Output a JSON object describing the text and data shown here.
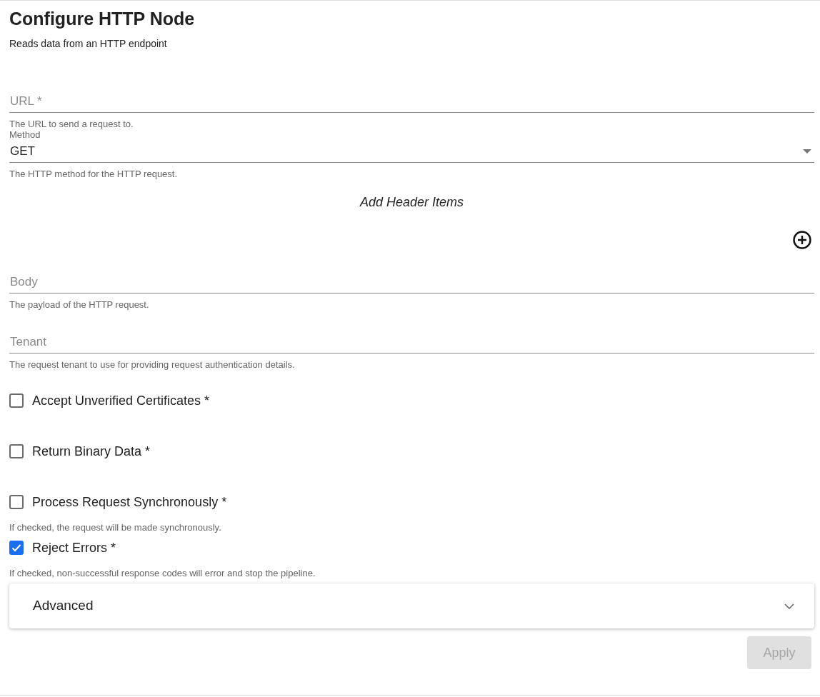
{
  "title": "Configure HTTP Node",
  "subtitle": "Reads data from an HTTP endpoint",
  "url_field": {
    "placeholder": "URL *",
    "helper": "The URL to send a request to."
  },
  "method_field": {
    "label": "Method",
    "value": "GET",
    "helper": "The HTTP method for the HTTP request."
  },
  "headers": {
    "title": "Add Header Items"
  },
  "body_field": {
    "placeholder": "Body",
    "helper": "The payload of the HTTP request."
  },
  "tenant_field": {
    "placeholder": "Tenant",
    "helper": "The request tenant to use for providing request authentication details."
  },
  "checkboxes": [
    {
      "label": "Accept Unverified Certificates *",
      "checked": false
    },
    {
      "label": "Return Binary Data *",
      "checked": false
    },
    {
      "label": "Process Request Synchronously *",
      "checked": false,
      "helper": "If checked, the request will be made synchronously."
    },
    {
      "label": "Reject Errors *",
      "checked": true,
      "helper": "If checked, non-successful response codes will error and stop the pipeline."
    }
  ],
  "advanced": {
    "title": "Advanced",
    "expanded": false
  },
  "apply_button": {
    "label": "Apply",
    "disabled": true
  }
}
